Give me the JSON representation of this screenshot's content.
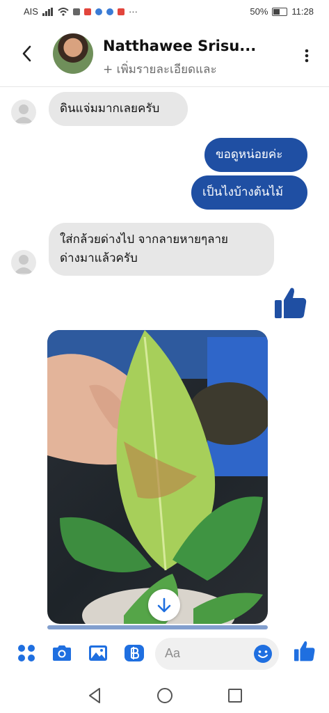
{
  "status": {
    "carrier": "AIS",
    "battery": "50%",
    "time": "11:28",
    "dots": "···"
  },
  "header": {
    "contact_name": "Natthawee Srisu...",
    "subtitle": "+ เพิ่มรายละเอียดและ"
  },
  "messages": [
    {
      "side": "in",
      "text": "ดินแจ่มมากเลยครับ"
    },
    {
      "side": "out",
      "text": "ขอดูหน่อยค่ะ"
    },
    {
      "side": "out",
      "text": "เป็นไงบ้างต้นไม้"
    },
    {
      "side": "in",
      "lines": [
        "ใส่กล้วยด่างไป จากลายหายๆลาย",
        "ด่างมาแล้วครับ"
      ]
    }
  ],
  "composer": {
    "placeholder": "Aa"
  },
  "colors": {
    "messenger_blue": "#1f6fe0",
    "outgoing_bubble": "#1f4fa3",
    "incoming_bubble": "#e7e7e7"
  },
  "icons": [
    "back-icon",
    "more-icon",
    "like-icon",
    "menu-icon",
    "camera-icon",
    "gallery-icon",
    "payment-icon",
    "emoji-icon",
    "download-icon",
    "nav-back-icon",
    "nav-home-icon",
    "nav-recent-icon"
  ]
}
